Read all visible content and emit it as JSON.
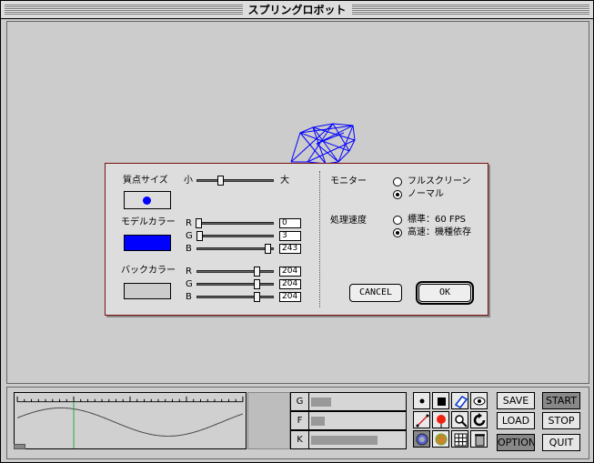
{
  "window": {
    "title": "スプリングロボット"
  },
  "dialog": {
    "mass_size": {
      "label": "質点サイズ",
      "min_label": "小",
      "max_label": "大",
      "slider_fraction": 0.3
    },
    "model_color": {
      "label": "モデルカラー",
      "swatch": "#0000ff",
      "channels": [
        {
          "name": "R",
          "value": "0",
          "fraction": 0.0
        },
        {
          "name": "G",
          "value": "3",
          "fraction": 0.01
        },
        {
          "name": "B",
          "value": "243",
          "fraction": 0.95
        }
      ]
    },
    "back_color": {
      "label": "バックカラー",
      "swatch": "#cccccc",
      "channels": [
        {
          "name": "R",
          "value": "204",
          "fraction": 0.8
        },
        {
          "name": "G",
          "value": "204",
          "fraction": 0.8
        },
        {
          "name": "B",
          "value": "204",
          "fraction": 0.8
        }
      ]
    },
    "monitor": {
      "label": "モニター",
      "options": [
        {
          "label": "フルスクリーン",
          "selected": false
        },
        {
          "label": "ノーマル",
          "selected": true
        }
      ]
    },
    "speed": {
      "label": "処理速度",
      "options": [
        {
          "label": "標準：60 FPS",
          "selected": false
        },
        {
          "label": "高速：機種依存",
          "selected": true
        }
      ]
    },
    "cancel_label": "CANCEL",
    "ok_label": "OK"
  },
  "bottom": {
    "gfk": [
      {
        "key": "G",
        "fraction": 0.22
      },
      {
        "key": "F",
        "fraction": 0.15
      },
      {
        "key": "K",
        "fraction": 0.72
      }
    ],
    "tools": [
      "point-icon",
      "square-icon",
      "eraser-icon",
      "eye-icon",
      "line-icon",
      "balloon-icon",
      "magnifier-icon",
      "rotate-icon",
      "ball-icon",
      "cookie-icon",
      "grid-icon",
      "trash-icon"
    ],
    "buttons": {
      "save": "SAVE",
      "load": "LOAD",
      "option": "OPTION",
      "start": "START",
      "stop": "STOP",
      "quit": "QUIT"
    }
  },
  "colors": {
    "model": "#0000ff",
    "dialog_border": "#7a1010",
    "wave": "#444444",
    "marker": "#22aa44"
  }
}
